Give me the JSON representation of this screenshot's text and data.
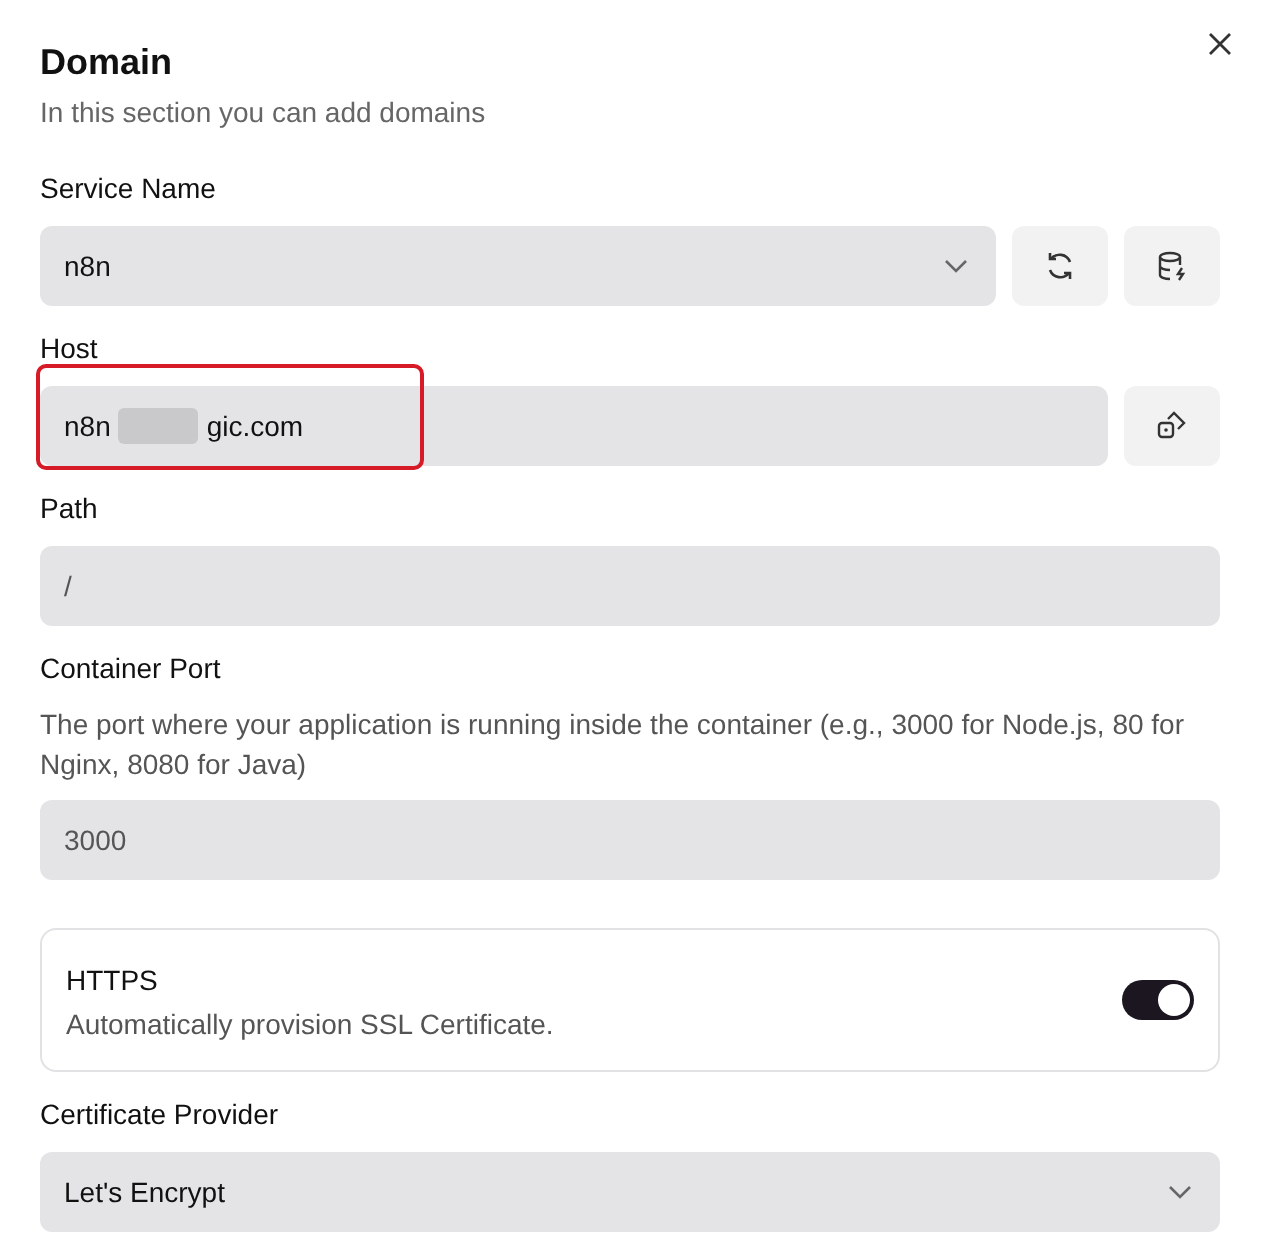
{
  "dialog": {
    "title": "Domain",
    "subtitle": "In this section you can add domains"
  },
  "service_name": {
    "label": "Service Name",
    "value": "n8n"
  },
  "host": {
    "label": "Host",
    "value_start": "n8n",
    "value_end": "gic.com",
    "redacted": true,
    "highlighted": true
  },
  "path": {
    "label": "Path",
    "value": "/"
  },
  "container_port": {
    "label": "Container Port",
    "description": "The port where your application is running inside the container (e.g., 3000 for Node.js, 80 for Nginx, 8080 for Java)",
    "value": "3000"
  },
  "https": {
    "title": "HTTPS",
    "description": "Automatically provision SSL Certificate.",
    "on": true
  },
  "certificate_provider": {
    "label": "Certificate Provider",
    "value": "Let's Encrypt"
  }
}
